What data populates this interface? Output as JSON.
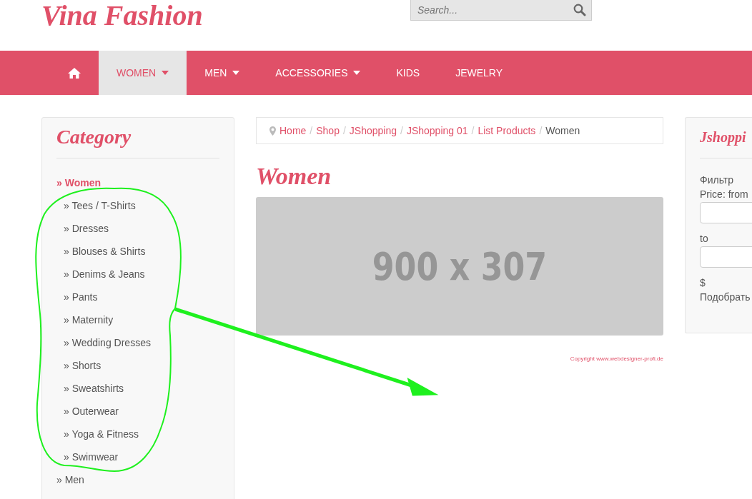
{
  "logo": "Vina Fashion",
  "search": {
    "placeholder": "Search..."
  },
  "nav": [
    {
      "kind": "home",
      "selected": false,
      "dropdown": false
    },
    {
      "label": "WOMEN",
      "kind": "link",
      "selected": true,
      "dropdown": true
    },
    {
      "label": "MEN",
      "kind": "link",
      "selected": false,
      "dropdown": true
    },
    {
      "label": "ACCESSORIES",
      "kind": "link",
      "selected": false,
      "dropdown": true
    },
    {
      "label": "KIDS",
      "kind": "link",
      "selected": false,
      "dropdown": false
    },
    {
      "label": "JEWELRY",
      "kind": "link",
      "selected": false,
      "dropdown": false
    }
  ],
  "category": {
    "title": "Category",
    "items": [
      {
        "label": "» Women",
        "selected": true,
        "children": [
          {
            "label": "» Tees / T-Shirts",
            "selected": false
          },
          {
            "label": "» Dresses",
            "selected": false
          },
          {
            "label": "» Blouses & Shirts",
            "selected": false
          },
          {
            "label": "» Denims & Jeans",
            "selected": false
          },
          {
            "label": "» Pants",
            "selected": false
          },
          {
            "label": "» Maternity",
            "selected": false
          },
          {
            "label": "» Wedding Dresses",
            "selected": false
          },
          {
            "label": "» Shorts",
            "selected": false
          },
          {
            "label": "» Sweatshirts",
            "selected": false
          },
          {
            "label": "» Outerwear",
            "selected": false
          },
          {
            "label": "» Yoga & Fitness",
            "selected": false
          },
          {
            "label": "» Swimwear",
            "selected": false
          }
        ]
      },
      {
        "label": "» Men",
        "selected": false
      }
    ]
  },
  "breadcrumb": [
    {
      "label": "Home",
      "kind": "link"
    },
    {
      "label": "/",
      "kind": "separator"
    },
    {
      "label": "Shop",
      "kind": "link"
    },
    {
      "label": "/",
      "kind": "separator"
    },
    {
      "label": "JShopping",
      "kind": "link"
    },
    {
      "label": "/",
      "kind": "separator"
    },
    {
      "label": "JShopping 01",
      "kind": "link"
    },
    {
      "label": "/",
      "kind": "separator"
    },
    {
      "label": "List Products",
      "kind": "link"
    },
    {
      "label": "/",
      "kind": "separator"
    },
    {
      "label": "Women",
      "kind": "current"
    }
  ],
  "heading": "Women",
  "banner": {
    "text": "900 x 307"
  },
  "copyright": "Copyright www.webdesigner-profi.de",
  "filter": {
    "title": "Jshoppi",
    "caption": "Фильтр",
    "from_label": "Price: from",
    "to_label": "to",
    "currency": "$",
    "submit": "Подобрать"
  }
}
